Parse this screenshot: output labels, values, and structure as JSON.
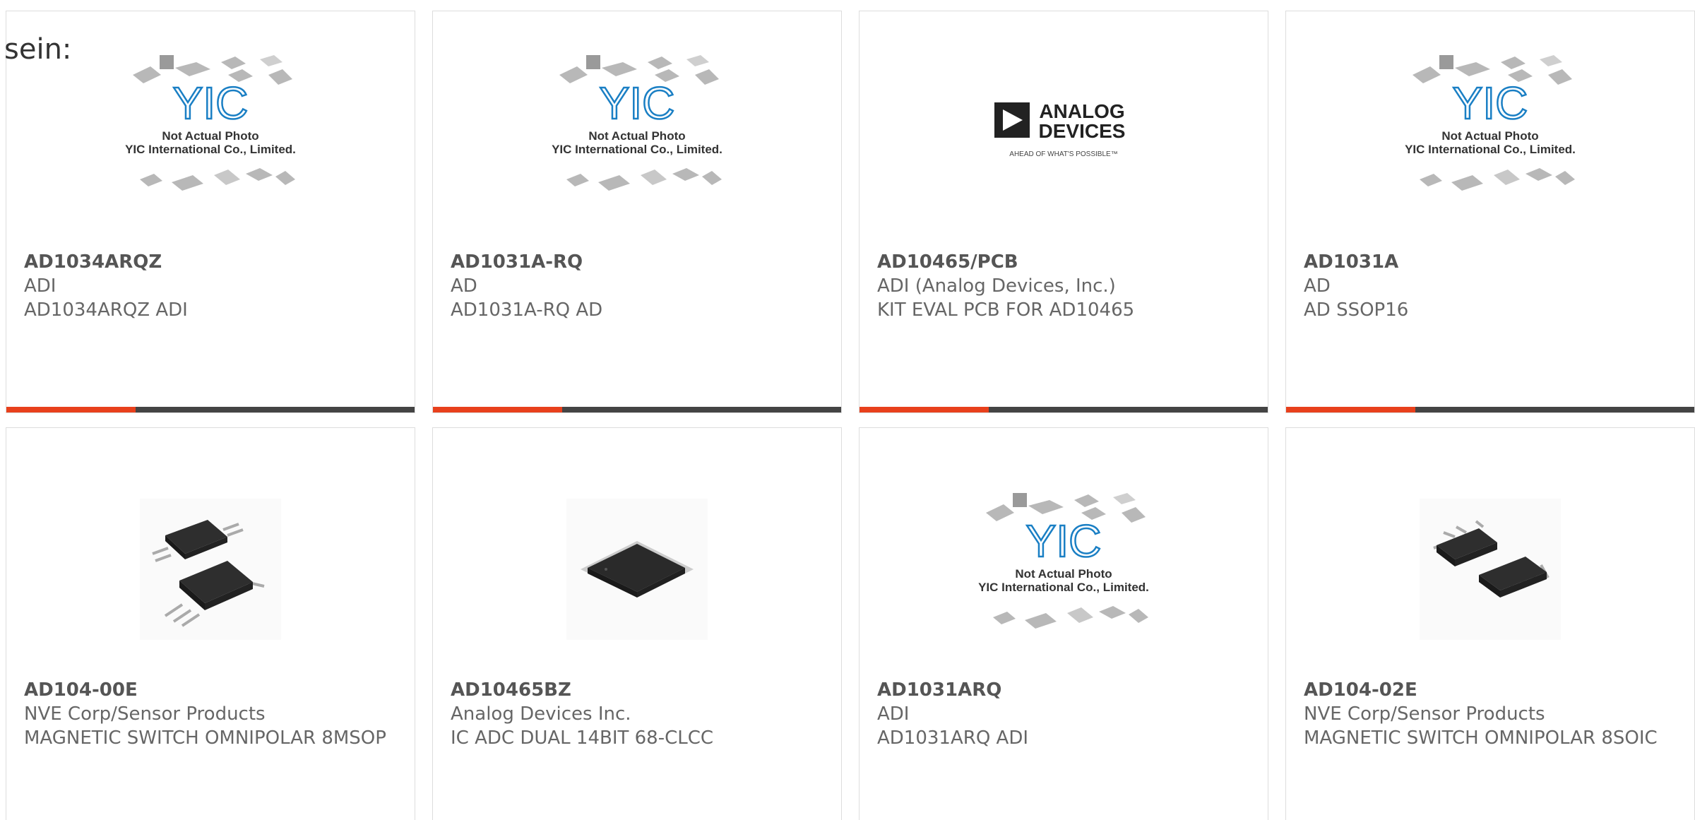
{
  "lead_text": "sein:",
  "placeholder": {
    "line1": "Not Actual Photo",
    "line2": "YIC International Co., Limited."
  },
  "adi_logo": {
    "line1": "ANALOG",
    "line2": "DEVICES",
    "tagline": "AHEAD OF WHAT'S POSSIBLE™"
  },
  "colors": {
    "accent": "#e8401c",
    "bar": "#444444",
    "border": "#dddddd",
    "logo_blue": "#1a7fc4"
  },
  "products": [
    {
      "part": "AD1034ARQZ",
      "maker": "ADI",
      "desc": "AD1034ARQZ ADI",
      "image": "yic-placeholder"
    },
    {
      "part": "AD1031A-RQ",
      "maker": "AD",
      "desc": "AD1031A-RQ AD",
      "image": "yic-placeholder"
    },
    {
      "part": "AD10465/PCB",
      "maker": "ADI (Analog Devices, Inc.)",
      "desc": "KIT EVAL PCB FOR AD10465",
      "image": "adi-logo"
    },
    {
      "part": "AD1031A",
      "maker": "AD",
      "desc": "AD SSOP16",
      "image": "yic-placeholder"
    },
    {
      "part": "AD104-00E",
      "maker": "NVE Corp/Sensor Products",
      "desc": "MAGNETIC SWITCH OMNIPOLAR 8MSOP",
      "image": "msop-chip"
    },
    {
      "part": "AD10465BZ",
      "maker": "Analog Devices Inc.",
      "desc": "IC ADC DUAL 14BIT 68-CLCC",
      "image": "qfp-chip"
    },
    {
      "part": "AD1031ARQ",
      "maker": "ADI",
      "desc": "AD1031ARQ ADI",
      "image": "yic-placeholder"
    },
    {
      "part": "AD104-02E",
      "maker": "NVE Corp/Sensor Products",
      "desc": "MAGNETIC SWITCH OMNIPOLAR 8SOIC",
      "image": "soic-chip"
    }
  ]
}
